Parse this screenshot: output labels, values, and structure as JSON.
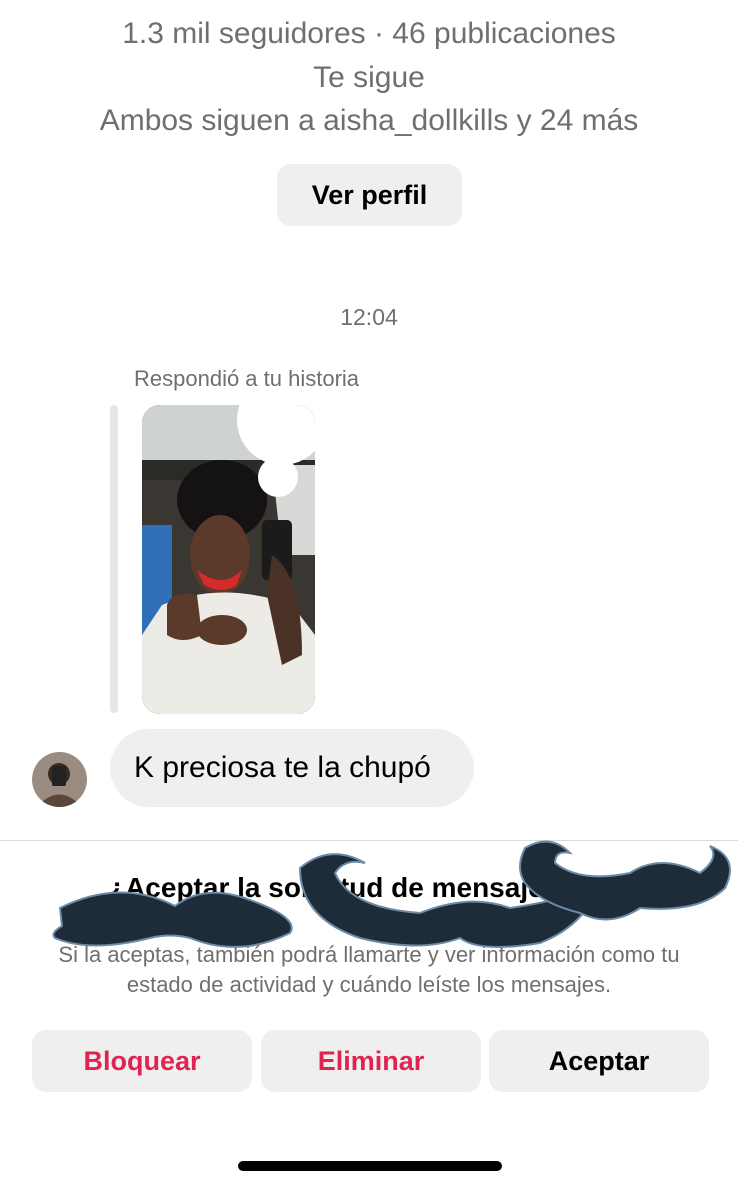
{
  "profile": {
    "followers_line": "1.3 mil seguidores · 46 publicaciones",
    "follows_you": "Te sigue",
    "mutuals": "Ambos siguen a aisha_dollkills y 24 más",
    "view_profile_label": "Ver perfil"
  },
  "conversation": {
    "timestamp": "12:04",
    "replied_label": "Respondió a tu historia",
    "message_text": "K preciosa te la chupó"
  },
  "request": {
    "title": "¿Aceptar la solicitud de mensaje de …?",
    "description": "Si la aceptas, también podrá llamarte y ver información como tu estado de actividad y cuándo leíste los mensajes.",
    "buttons": {
      "block": "Bloquear",
      "delete": "Eliminar",
      "accept": "Aceptar"
    }
  },
  "colors": {
    "destructive": "#e0244f",
    "button_bg": "#efefef",
    "secondary_text": "#6f6f6f",
    "mustache": "#1e2b38"
  }
}
